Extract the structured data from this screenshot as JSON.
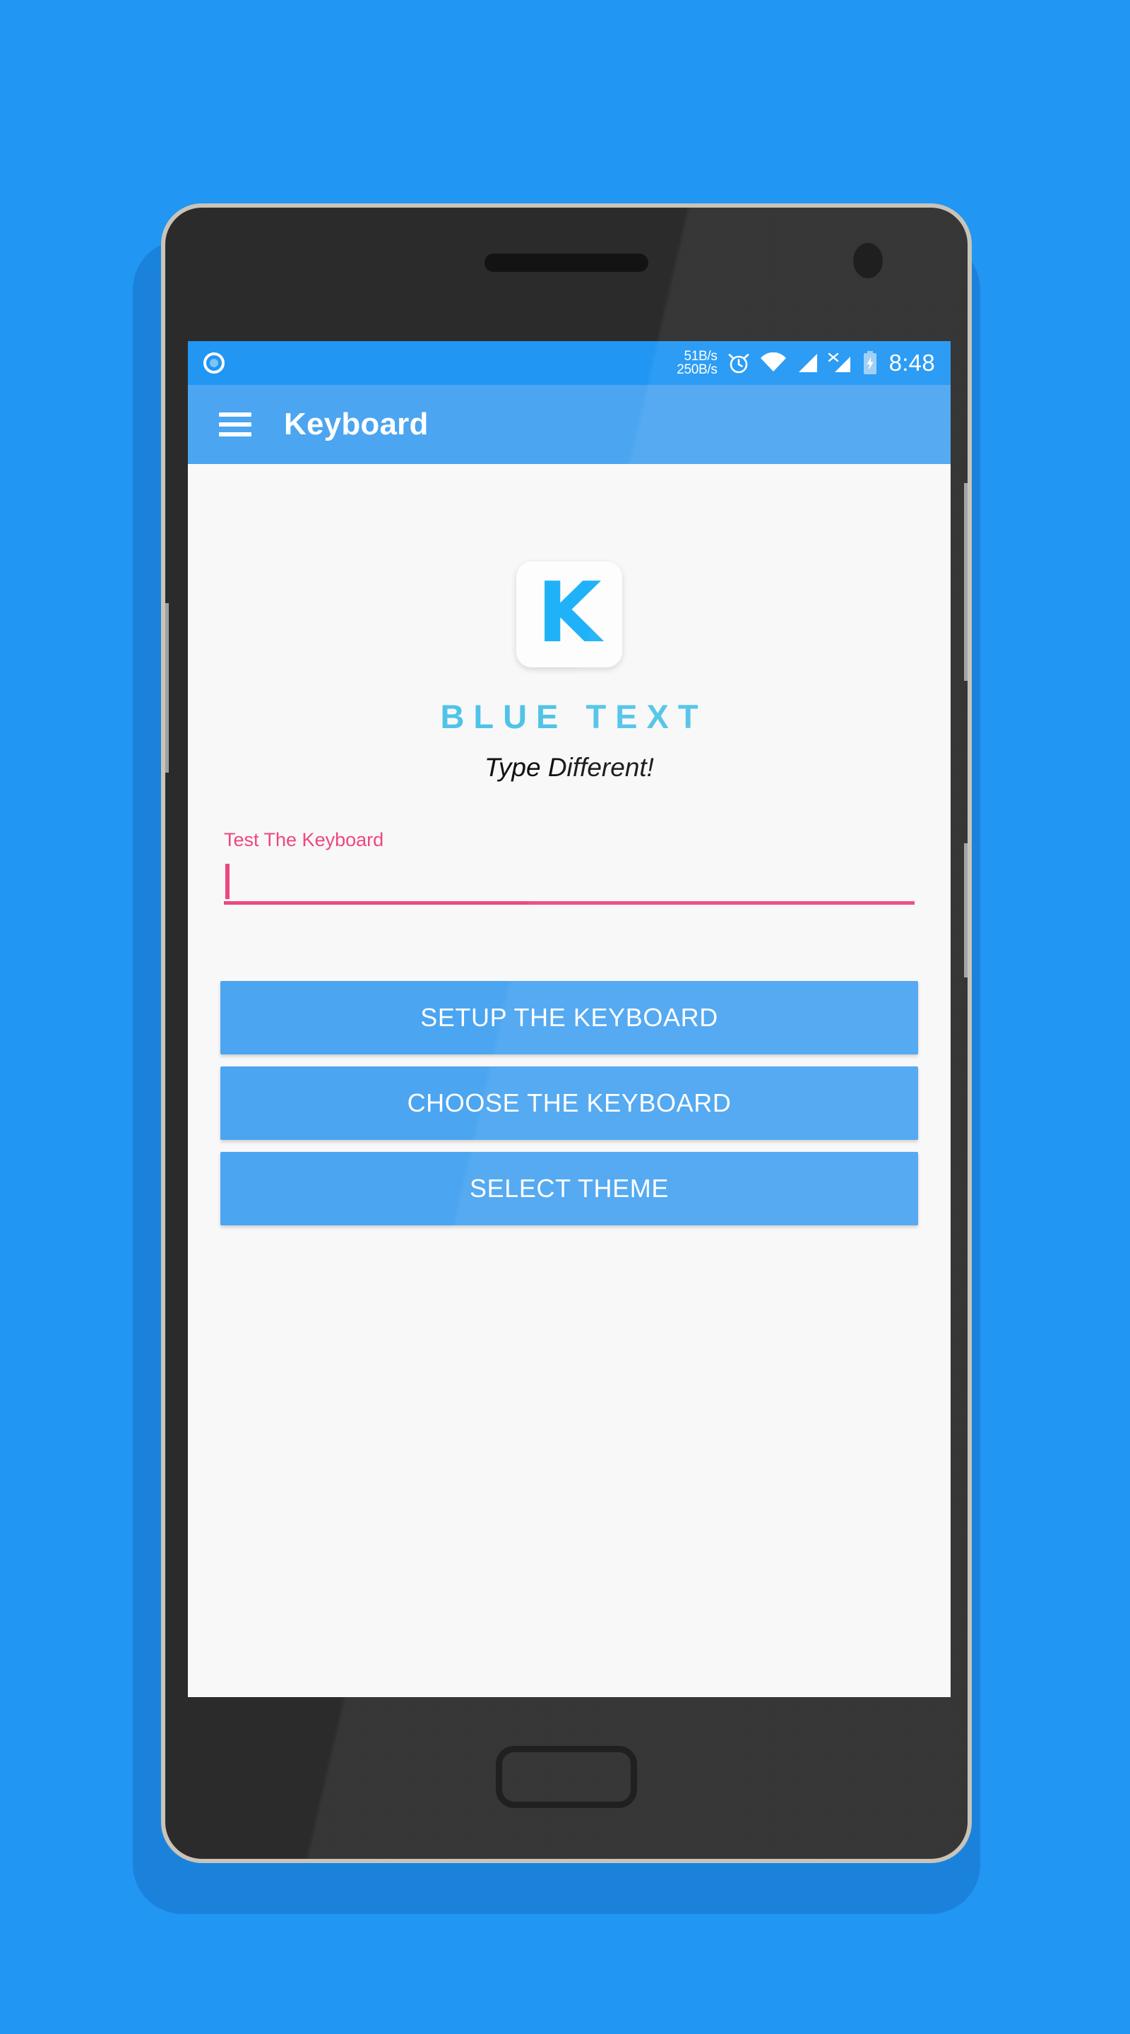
{
  "theme": {
    "page_background": "#2196F3",
    "status_bar_color": "#2196F3",
    "app_bar_color": "#4BA5F0",
    "screen_background": "#F8F8F8",
    "accent_pink": "#EE4682",
    "brand_blue": "#4FC3E8",
    "logo_blue": "#20B2F8",
    "button_blue": "#4BA5F0"
  },
  "status_bar": {
    "notification_icon": "circle-notification-icon",
    "net_speed_up": "51B/s",
    "net_speed_down": "250B/s",
    "alarm_icon": "alarm-clock-icon",
    "wifi_icon": "wifi-icon",
    "signal_icon_1": "signal-bars-icon",
    "signal_icon_2": "signal-no-service-icon",
    "battery_icon": "battery-charging-icon",
    "clock": "8:48"
  },
  "app_bar": {
    "menu_icon": "hamburger-menu-icon",
    "title": "Keyboard"
  },
  "branding": {
    "logo_letter": "K",
    "name": "BLUE TEXT",
    "tagline": "Type Different!"
  },
  "test_field": {
    "label": "Test The Keyboard",
    "value": "",
    "placeholder": ""
  },
  "actions": [
    {
      "label": "SETUP THE KEYBOARD"
    },
    {
      "label": "CHOOSE THE KEYBOARD"
    },
    {
      "label": "SELECT THEME"
    }
  ],
  "device": {
    "earpiece": "earpiece-speaker",
    "front_camera": "front-camera-icon",
    "home_button": "home-button",
    "volume_key": "volume-rocker-key",
    "power_key": "power-key"
  }
}
